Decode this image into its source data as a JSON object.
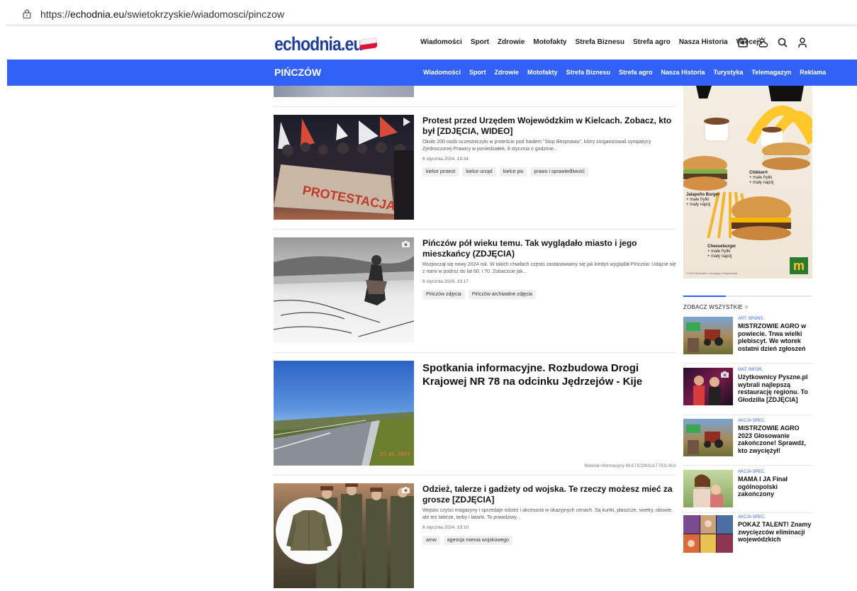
{
  "browser": {
    "url_prefix": "https://",
    "url_domain": "echodnia.eu",
    "url_path": "/swietokrzyskie/wiadomosci/pinczow"
  },
  "header": {
    "logo": "echodnia.eu",
    "menu": [
      "Wiadomości",
      "Sport",
      "Zdrowie",
      "Motofakty",
      "Strefa Biznesu",
      "Strefa agro",
      "Nasza Historia",
      "Więcej"
    ],
    "icons": [
      "add-square-icon",
      "weather-icon",
      "search-icon",
      "user-icon"
    ]
  },
  "section": {
    "city": "PIŃCZÓW",
    "menu": [
      "Wiadomości",
      "Sport",
      "Zdrowie",
      "Motofakty",
      "Strefa Biznesu",
      "Strefa agro",
      "Nasza Historia",
      "Turystyka",
      "Telemagazyn",
      "Reklama"
    ]
  },
  "articles": [
    {
      "title": "Protest przed Urzędem Wojewódzkim w Kielcach. Zobacz, kto był [ZDJĘCIA, WIDEO]",
      "lead": "Około 200 osób uczestniczyło w proteście pod hasłem \"Stop Bezprawiu\", który zorganizowali sympatycy Zjednoczonej Prawicy w poniedziałek, 8 stycznia o godzinie...",
      "date": "8 stycznia 2024, 19:24",
      "tags": [
        "kielce protest",
        "kielce urząd",
        "kielce pis",
        "prawo i sprawiedliwość"
      ]
    },
    {
      "title": "Pińczów pół wieku temu. Tak wyglądało miasto i jego mieszkańcy (ZDJĘCIA)",
      "lead": "Rozpoczął się nowy 2024 rok. W takich chwilach często zastanawiamy się jak kiedyś wyglądał Pińczów. Udajcie się z nami w podróż do lat 60. i 70. Zobaczcie jak...",
      "date": "8 stycznia 2024, 19:17",
      "tags": [
        "Pińczów zdjęcia",
        "Pińczów archiwalne zdjęcia"
      ]
    },
    {
      "title": "Spotkania informacyjne. Rozbudowa Drogi Krajowej NR 78 na odcinku Jędrzejów - Kije",
      "sponsor": "Materiał informacyjny MULTICONSULT POLSKA",
      "img_stamp": "25.01.2023"
    },
    {
      "title": "Odzież, talerze i gadżety od wojska. Te rzeczy możesz mieć za grosze [ZDJĘCIA]",
      "lead": "Wojsko czyści magazyny i sprzedaje odzież i akcesoria w okazyjnych cenach. Są kurtki, płaszcze, swetry, obuwie, ale też talerze, torby i latarki. To prawdziwy...",
      "date": "8 stycznia 2024, 19:10",
      "tags": [
        "amw",
        "agencja mienia wojskowego"
      ]
    }
  ],
  "ad": {
    "chikker": "Chikker®",
    "chikker_sub": "+ małe frytki\n+ mały napój",
    "jalapeno": "Jalapeño Burger",
    "jalapeno_sub": "+ małe frytki\n+ mały napój",
    "cheese": "Cheeseburger",
    "cheese_sub": "+ małe frytki\n+ mały napój",
    "footer": "© 2023 McDonald's. Szczegóły w Regulaminie"
  },
  "sidebar": {
    "see_all": "ZOBACZ WSZYSTKIE",
    "see_all_arrow": ">",
    "items": [
      {
        "kind": "ART. SPONS.",
        "title": "MISTRZOWIE AGRO w powiecie. Trwa wielki plebiscyt. We wtorek ostatni dzień zgłoszeń"
      },
      {
        "kind": "MAT. INFOR.",
        "title": "Użytkownicy Pyszne.pl wybrali najlepszą restaurację regionu. To Głodzilla [ZDJĘCIA]"
      },
      {
        "kind": "AKCJA SPEC.",
        "title": "MISTRZOWIE AGRO 2023 Głosowanie zakończone! Sprawdź, kto zwyciężył!"
      },
      {
        "kind": "AKCJA SPEC.",
        "title": "MAMA I JA Finał ogólnopolski zakończony"
      },
      {
        "kind": "AKCJA SPEC.",
        "title": "POKAZ TALENT! Znamy zwycięzców eliminacji wojewódzkich"
      }
    ]
  },
  "colors": {
    "accent": "#3261f5",
    "logo": "#1d3f99"
  }
}
